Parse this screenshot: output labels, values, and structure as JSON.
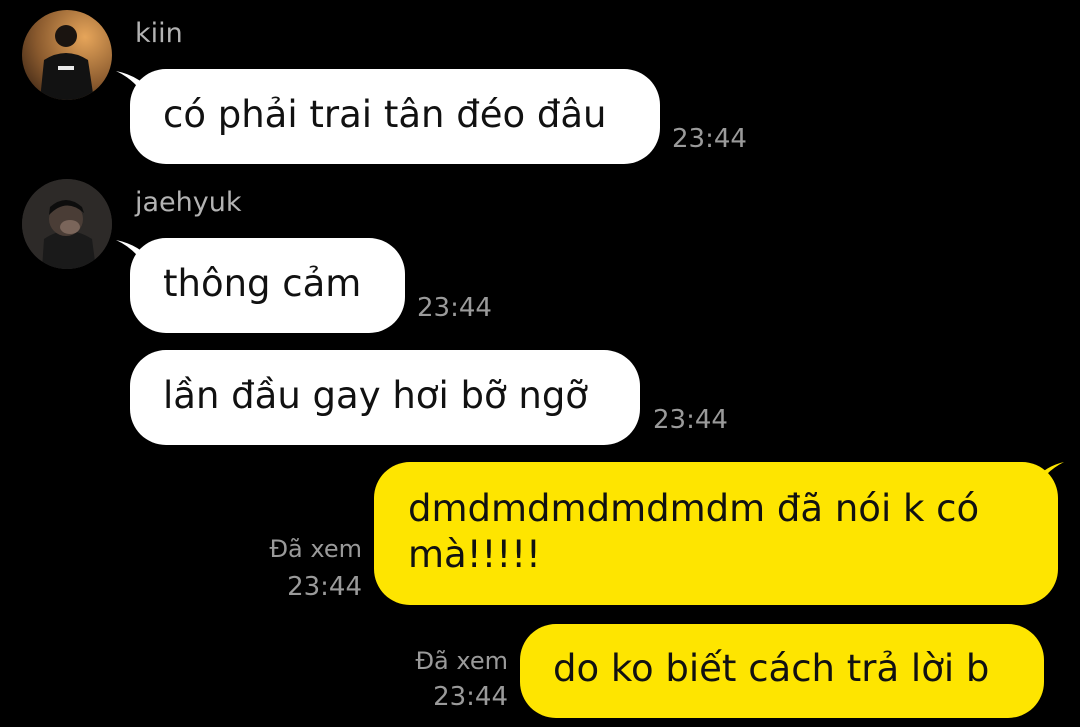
{
  "messages": [
    {
      "sender": "kiin",
      "text": "có phải trai tân đéo đâu",
      "time": "23:44"
    },
    {
      "sender": "jaehyuk",
      "text": "thông cảm",
      "time": "23:44"
    },
    {
      "text": "lần đầu gay hơi bỡ ngỡ",
      "time": "23:44"
    },
    {
      "text_line1": "dmdmdmdmdmdm đã nói k có",
      "text_line2": "mà!!!!!",
      "status": "Đã xem",
      "time": "23:44"
    },
    {
      "text": "do ko biết cách trả lời b",
      "status": "Đã xem",
      "time": "23:44"
    }
  ],
  "colors": {
    "background": "#000000",
    "incoming_bubble": "#ffffff",
    "outgoing_bubble": "#fee500",
    "meta_text": "#9a9a9a"
  }
}
